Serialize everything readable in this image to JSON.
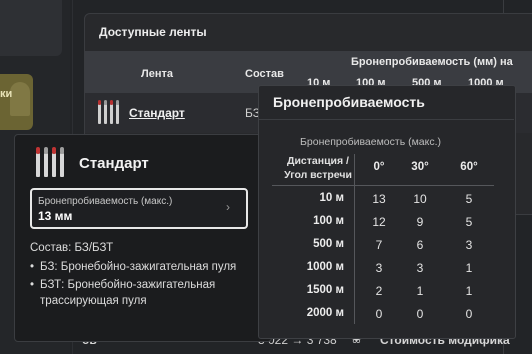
{
  "sidebar": {
    "partial_label": "ки"
  },
  "main_panel": {
    "title": "Доступные ленты",
    "columns": {
      "lenta": "Лента",
      "sostav": "Состав",
      "penetration_group": "Бронепробиваемость (мм) на",
      "dist_10": "10 м",
      "dist_100": "100 м",
      "dist_500": "500 м",
      "dist_1000": "1000 м"
    },
    "rows": [
      {
        "name": "Стандарт",
        "sostav_partial": "БЗ"
      }
    ]
  },
  "bottom_bar": {
    "left_partial": "ов",
    "price_change": "3 022 → 3 738",
    "modifications_partial": "Стоимость модифика",
    "right_partial": "д"
  },
  "tooltip_belt": {
    "title": "Стандарт",
    "penetration": {
      "label": "Бронепробиваемость (макс.)",
      "value": "13 мм"
    },
    "composition": "Состав: БЗ/БЗТ",
    "bullets": [
      "БЗ: Бронебойно-зажигательная пуля",
      "БЗТ: Бронебойно-зажигательная трассирующая пуля"
    ]
  },
  "tooltip_penetration": {
    "title": "Бронепробиваемость",
    "subtitle": "Бронепробиваемость (макс.)",
    "corner_header": [
      "Дистанция /",
      "Угол встречи"
    ],
    "angles": [
      "0°",
      "30°",
      "60°"
    ],
    "rows": [
      {
        "distance": "10 м",
        "values": [
          "13",
          "10",
          "5"
        ]
      },
      {
        "distance": "100 м",
        "values": [
          "12",
          "9",
          "5"
        ]
      },
      {
        "distance": "500 м",
        "values": [
          "7",
          "6",
          "3"
        ]
      },
      {
        "distance": "1000 м",
        "values": [
          "3",
          "3",
          "1"
        ]
      },
      {
        "distance": "1500 м",
        "values": [
          "2",
          "1",
          "1"
        ]
      },
      {
        "distance": "2000 м",
        "values": [
          "0",
          "0",
          "0"
        ]
      }
    ]
  },
  "colors": {
    "background": "#222427",
    "tooltip": "#1b1c1e",
    "accent_frame": "#e8e8e8"
  }
}
